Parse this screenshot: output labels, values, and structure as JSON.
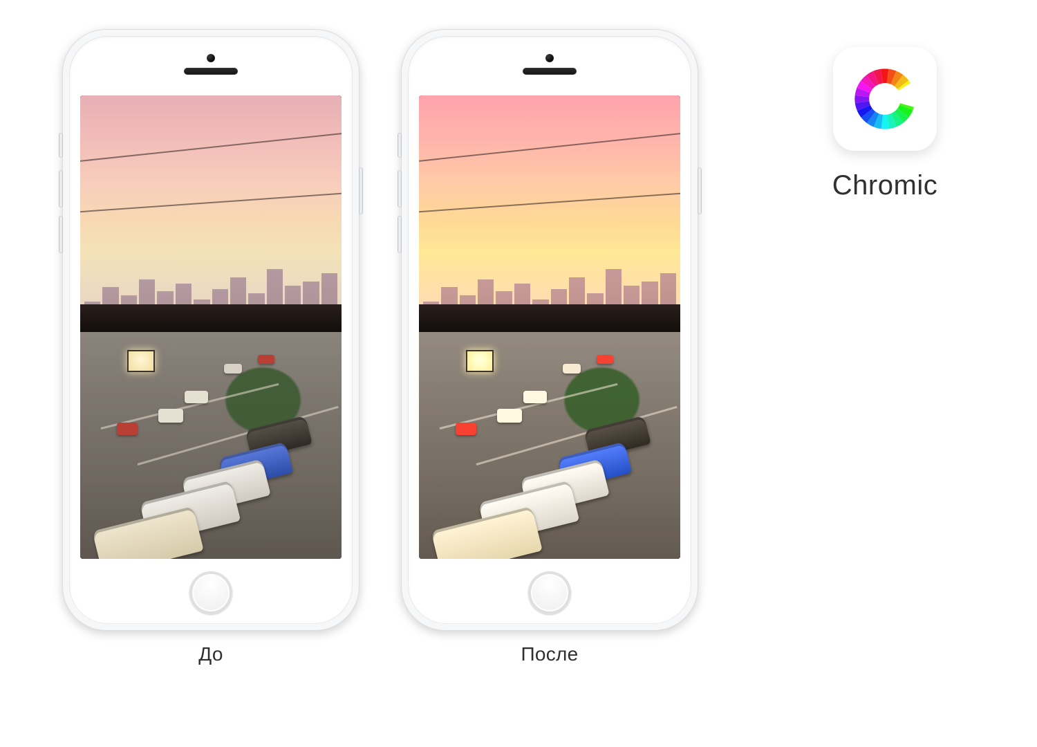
{
  "comparison": {
    "before_label": "До",
    "after_label": "После"
  },
  "app": {
    "name": "Chromic",
    "icon_semantic": "chromic-color-wheel-c-icon"
  },
  "colors": {
    "ring_stops": [
      "#e23b3b",
      "#ef7f1a",
      "#f6c21a",
      "#a7d129",
      "#34c759",
      "#18b7c4",
      "#2f86f6",
      "#6a4cf4",
      "#c43bd1",
      "#e23b7b",
      "#e23b3b"
    ]
  }
}
